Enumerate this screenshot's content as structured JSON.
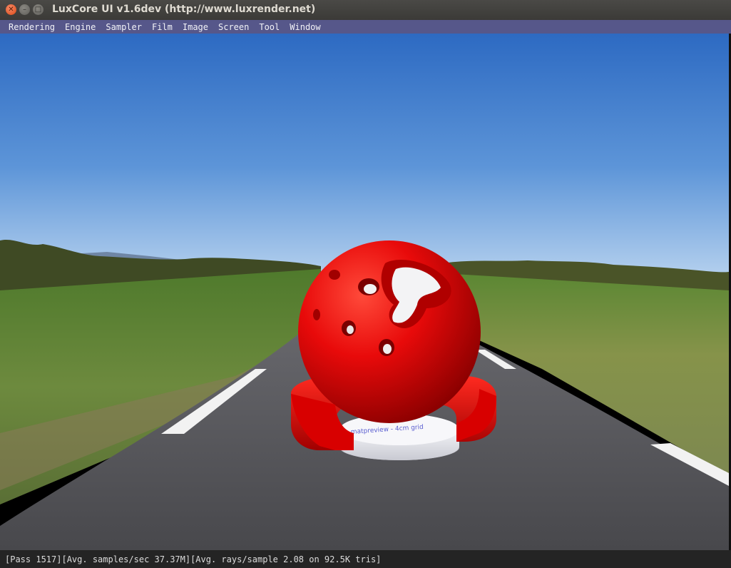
{
  "window": {
    "title": "LuxCore UI v1.6dev (http://www.luxrender.net)",
    "controls": {
      "close_icon": "close-icon",
      "minimize_icon": "minimize-icon",
      "maximize_icon": "maximize-icon"
    }
  },
  "menu": {
    "items": [
      "Rendering",
      "Engine",
      "Sampler",
      "Film",
      "Image",
      "Screen",
      "Tool",
      "Window"
    ]
  },
  "render": {
    "scene": "red cheese-ball material preview on a road with grass fields and blue sky",
    "colors": {
      "sky_top": "#2f6cc3",
      "sky_bottom": "#a8c9ec",
      "ball": "#e00808",
      "grass": "#6b8a3a",
      "road": "#55555a"
    },
    "base_label": "matpreview - 4cm grid"
  },
  "status": {
    "text": "[Pass 1517][Avg. samples/sec  37.37M][Avg. rays/sample 2.08 on 92.5K tris]"
  }
}
